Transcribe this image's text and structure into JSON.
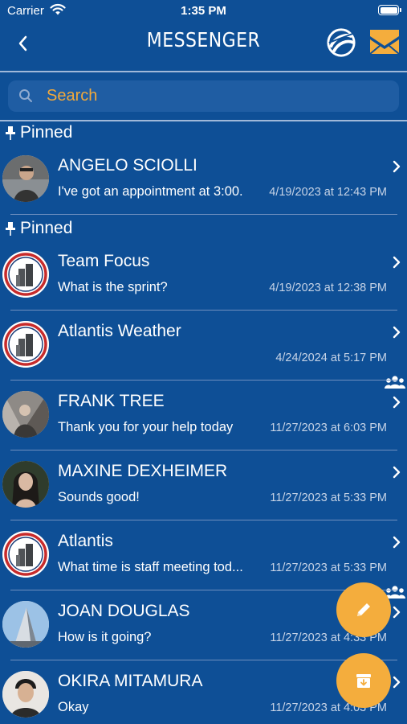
{
  "status_bar": {
    "carrier": "Carrier",
    "time": "1:35 PM"
  },
  "header": {
    "title": "MESSENGER",
    "back_label": "<"
  },
  "search": {
    "placeholder": "Search"
  },
  "colors": {
    "background": "#0e4f96",
    "accent": "#f4ad3d",
    "search_text": "#f2a93b"
  },
  "sections": [
    {
      "header": "Pinned",
      "rows": [
        {
          "name": "ANGELO SCIOLLI",
          "preview": "I've got an appointment at 3:00.",
          "time": "4/19/2023 at 12:43 PM",
          "avatar": "photo-person"
        }
      ]
    },
    {
      "header": "Pinned",
      "rows": [
        {
          "name": "Team Focus",
          "preview": "What is the sprint?",
          "time": "4/19/2023 at 12:38 PM",
          "avatar": "building-logo"
        },
        {
          "name": "Atlantis Weather",
          "preview": "",
          "time": "4/24/2024 at 5:17 PM",
          "avatar": "building-logo",
          "group": true
        },
        {
          "name": "FRANK TREE",
          "preview": "Thank you for your help today",
          "time": "11/27/2023 at 6:03 PM",
          "avatar": "photo-person"
        },
        {
          "name": "MAXINE DEXHEIMER",
          "preview": "Sounds good!",
          "time": "11/27/2023 at 5:33 PM",
          "avatar": "photo-person"
        },
        {
          "name": "Atlantis",
          "preview": "What time is staff meeting tod...",
          "time": "11/27/2023 at 5:33 PM",
          "avatar": "building-logo",
          "group": true
        },
        {
          "name": "JOAN DOUGLAS",
          "preview": "How is it going?",
          "time": "11/27/2023 at 4:33 PM",
          "avatar": "photo-building"
        },
        {
          "name": "OKIRA MITAMURA",
          "preview": "Okay",
          "time": "11/27/2023 at 4:03 PM",
          "avatar": "photo-person"
        }
      ]
    }
  ],
  "icons": {
    "back": "chevron-left-icon",
    "brand": "brand-logo-icon",
    "mail": "mail-icon",
    "search": "search-icon",
    "pin": "pin-icon",
    "group": "group-icon",
    "chevron": "chevron-right-icon",
    "compose": "pencil-icon",
    "archive": "archive-icon"
  }
}
